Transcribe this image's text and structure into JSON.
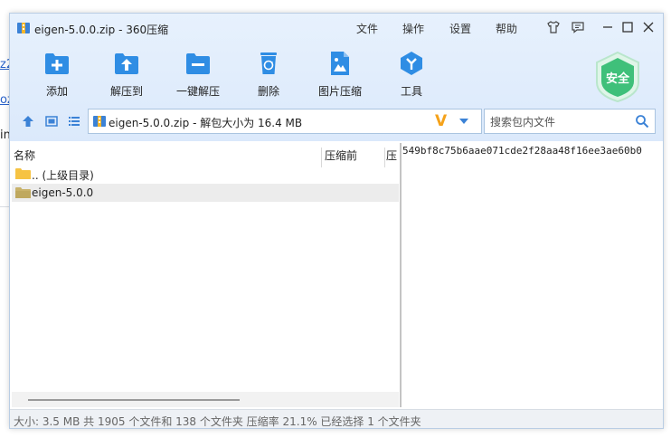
{
  "background": {
    "frag1": "z2",
    "frag2": "oz",
    "frag3": "in"
  },
  "window": {
    "title": "eigen-5.0.0.zip - 360压缩",
    "menu": [
      "文件",
      "操作",
      "设置",
      "帮助"
    ]
  },
  "toolbar": {
    "items": [
      {
        "label": "添加",
        "icon": "add-icon"
      },
      {
        "label": "解压到",
        "icon": "extract-to-icon"
      },
      {
        "label": "一键解压",
        "icon": "one-click-extract-icon"
      },
      {
        "label": "删除",
        "icon": "recycle-bin-icon"
      },
      {
        "label": "图片压缩",
        "icon": "image-compress-icon"
      },
      {
        "label": "工具",
        "icon": "tools-icon"
      }
    ],
    "security_badge": "安全"
  },
  "address": {
    "text": "eigen-5.0.0.zip - 解包大小为 16.4 MB",
    "badge": "V"
  },
  "search": {
    "placeholder": "搜索包内文件"
  },
  "file_list": {
    "columns": [
      "名称",
      "压缩前",
      "压"
    ],
    "rows": [
      {
        "name": ".. (上级目录)",
        "selected": false
      },
      {
        "name": "eigen-5.0.0",
        "selected": true
      }
    ]
  },
  "preview": {
    "text": "549bf8c75b6aae071cde2f28aa48f16ee3ae60b0"
  },
  "status": {
    "text": "大小: 3.5 MB 共 1905 个文件和 138 个文件夹 压缩率 21.1% 已经选择 1 个文件夹"
  },
  "colors": {
    "accent": "#2f8de4",
    "chrome": "#dbe9fb",
    "badge": "#f5a21a",
    "security": "#3fc07a"
  }
}
